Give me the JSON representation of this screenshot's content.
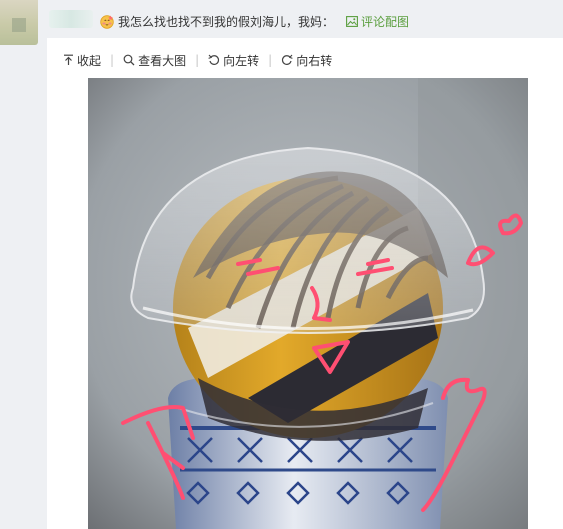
{
  "comment": {
    "text": "我怎么找也找不到我的假刘海儿，我妈：",
    "emoji_icon": "blush-face-icon",
    "comment_image_label": "评论配图",
    "comment_image_icon": "image-icon"
  },
  "toolbar": {
    "items": [
      {
        "label": "收起",
        "icon": "arrow-up-icon"
      },
      {
        "label": "查看大图",
        "icon": "magnifier-icon"
      },
      {
        "label": "向左转",
        "icon": "rotate-left-icon"
      },
      {
        "label": "向右转",
        "icon": "rotate-right-icon"
      }
    ]
  },
  "photo": {
    "accent_color": "#ff4f72",
    "link_color": "#5a9e3e"
  }
}
